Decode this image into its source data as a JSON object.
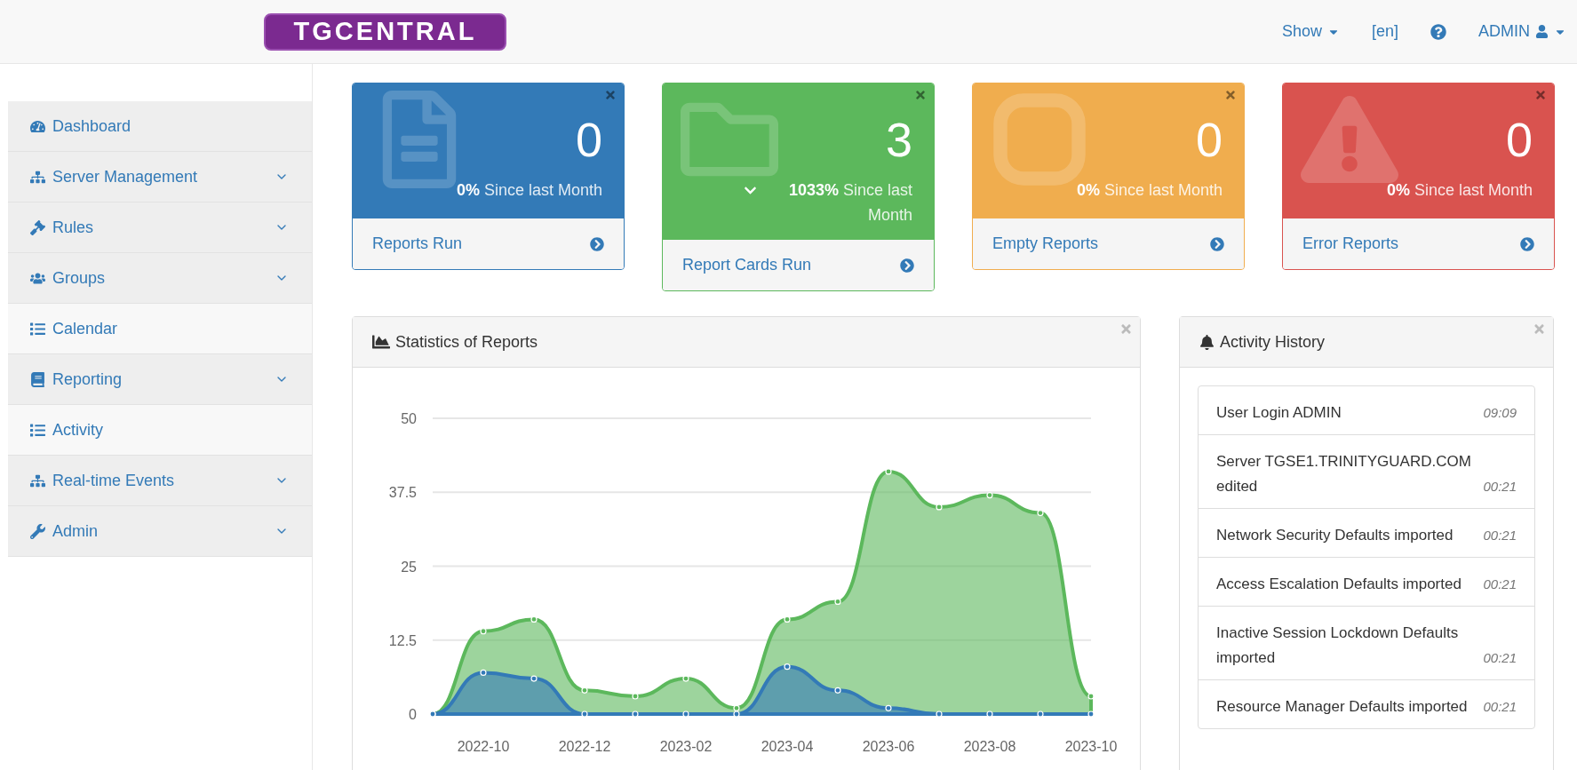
{
  "header": {
    "logo": "TGCENTRAL",
    "nav": [
      {
        "kind": "dropdown",
        "label": "Show"
      },
      {
        "kind": "link",
        "label": "[en]"
      },
      {
        "kind": "help"
      },
      {
        "kind": "user",
        "label": "ADMIN"
      }
    ]
  },
  "sidebar": {
    "items": [
      {
        "kind": "link",
        "label": "Dashboard"
      },
      {
        "kind": "group",
        "label": "Server Management"
      },
      {
        "kind": "group",
        "label": "Rules"
      },
      {
        "kind": "group",
        "label": "Groups"
      },
      {
        "kind": "page",
        "label": "Calendar"
      },
      {
        "kind": "group",
        "label": "Reporting"
      },
      {
        "kind": "page",
        "label": "Activity"
      },
      {
        "kind": "group",
        "label": "Real-time Events"
      },
      {
        "kind": "group",
        "label": "Admin"
      }
    ]
  },
  "cards": [
    {
      "kind": "primary",
      "count": "0",
      "falling": false,
      "change": "**0%** Since last Month",
      "label": "Reports Run"
    },
    {
      "kind": "success",
      "count": "3",
      "falling": true,
      "change": "**1033%** Since last Month",
      "label": "Report Cards Run"
    },
    {
      "kind": "warning",
      "count": "0",
      "falling": false,
      "change": "**0%** Since last Month",
      "label": "Empty Reports"
    },
    {
      "kind": "danger",
      "count": "0",
      "falling": false,
      "change": "**0%** Since last Month",
      "label": "Error Reports"
    }
  ],
  "statistics": {
    "title": "Statistics of Reports",
    "chart_data": {
      "type": "area",
      "x": [
        "2022-09",
        "2022-10",
        "2022-11",
        "2022-12",
        "2023-01",
        "2023-02",
        "2023-03",
        "2023-04",
        "2023-05",
        "2023-06",
        "2023-07",
        "2023-08",
        "2023-09",
        "2023-10"
      ],
      "series": [
        {
          "color": "#5cb85c",
          "values": [
            0,
            14,
            16,
            4,
            3,
            6,
            1,
            16,
            19,
            41,
            35,
            37,
            34,
            3
          ]
        },
        {
          "color": "#337ab7",
          "values": [
            0,
            7,
            6,
            0,
            0,
            0,
            0,
            8,
            4,
            1,
            0,
            0,
            0,
            0
          ]
        }
      ],
      "xlim": [
        "2022-09",
        "2023-10"
      ],
      "ylim": [
        0,
        50
      ],
      "grid": true,
      "yticks": [
        0,
        12.5,
        25,
        37.5,
        50
      ],
      "xticks": [
        "2022-10",
        "2022-12",
        "2023-02",
        "2023-04",
        "2023-06",
        "2023-08",
        "2023-10"
      ],
      "stacked": false
    }
  },
  "activity": {
    "title": "Activity History",
    "entries": [
      {
        "text": "User Login ADMIN",
        "time": "09:09"
      },
      {
        "text": "Server TGSE1.TRINITYGUARD.COM edited",
        "time": "00:21"
      },
      {
        "text": "Network Security Defaults imported",
        "time": "00:21"
      },
      {
        "text": "Access Escalation Defaults imported",
        "time": "00:21"
      },
      {
        "text": "Inactive Session Lockdown Defaults imported",
        "time": "00:21"
      },
      {
        "text": "Resource Manager Defaults imported",
        "time": "00:21"
      }
    ]
  }
}
